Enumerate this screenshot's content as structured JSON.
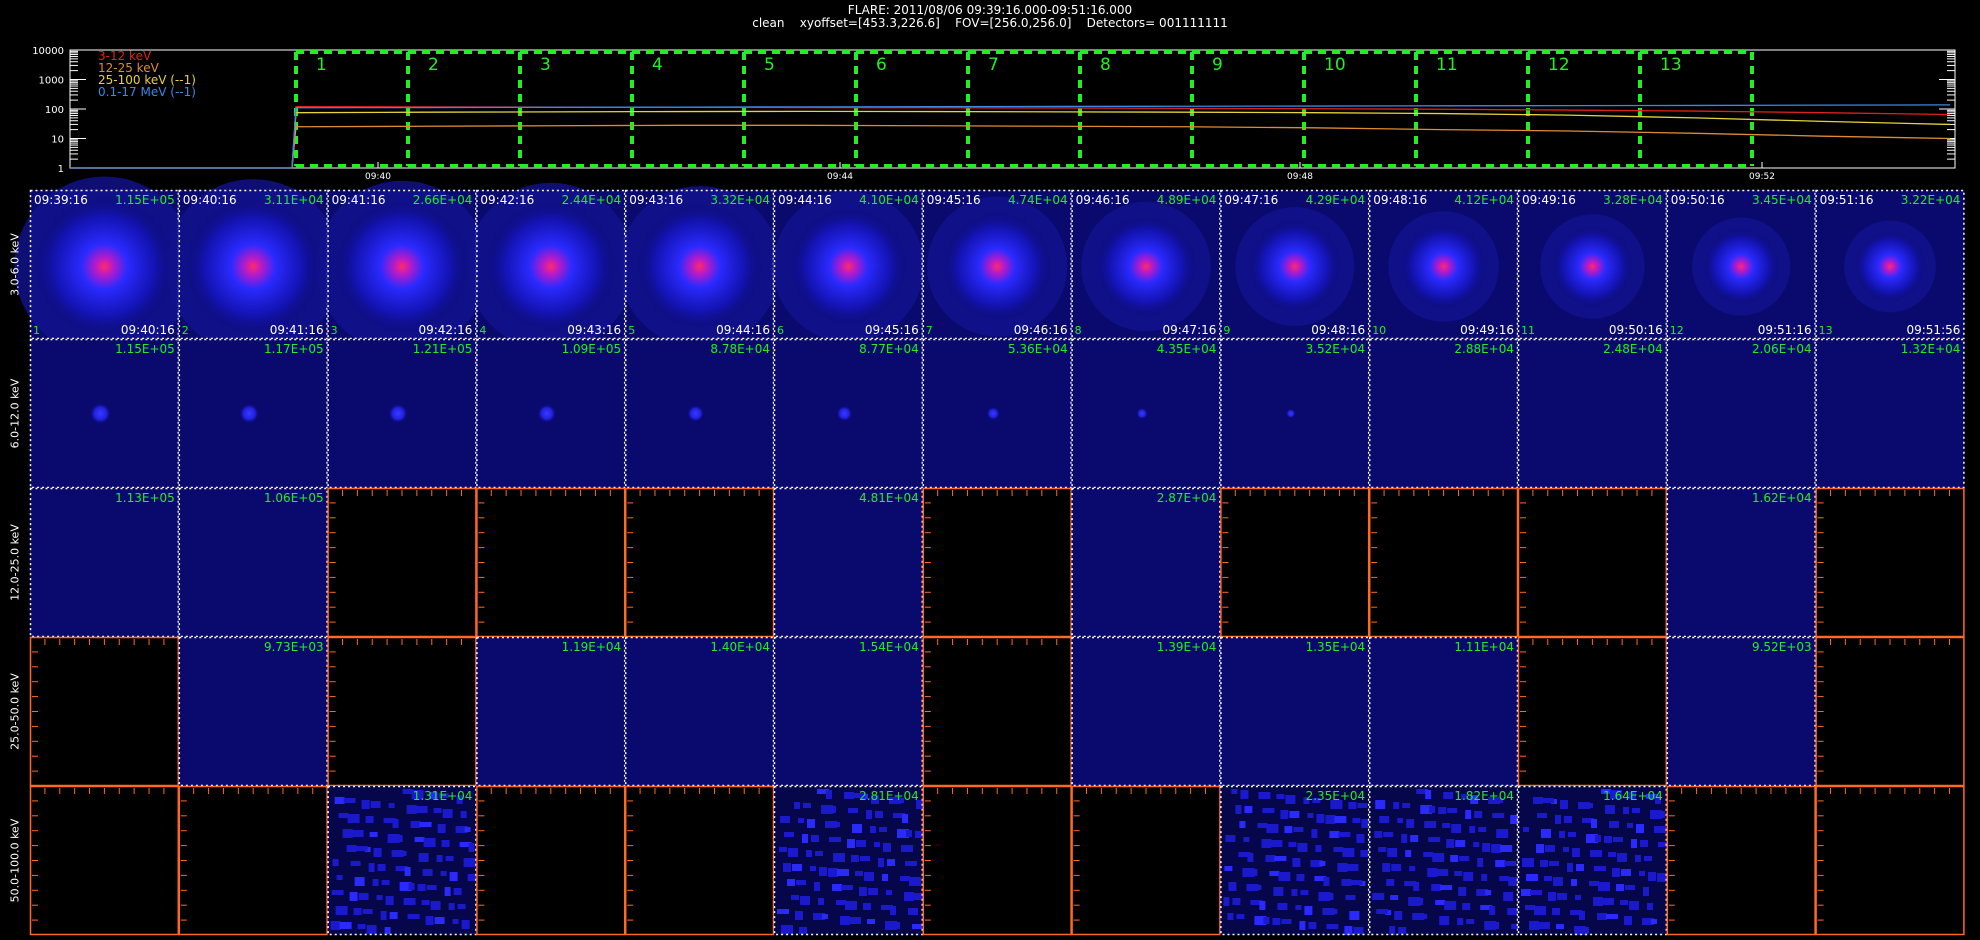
{
  "header": {
    "line1": "FLARE: 2011/08/06 09:39:16.000-09:51:16.000",
    "line2": "clean    xyoffset=[453.3,226.6]    FOV=[256.0,256.0]    Detectors= 001111111"
  },
  "colors": {
    "bg": "#000000",
    "c3_12": "#e0201c",
    "c12_25": "#e08a30",
    "c25_100": "#e6d23a",
    "c01_17": "#3a88e8",
    "interval": "#22ee22",
    "counts_label": "#22ee22",
    "frame_white": "#ffffff",
    "frame_orange": "#ff6a22",
    "image_blue": "#0a0a6e"
  },
  "chart_data": [
    {
      "type": "line",
      "title": "",
      "ylabel": "",
      "yscale": "log",
      "ylim": [
        1,
        10000
      ],
      "y_ticks": [
        "10000",
        "1000",
        "100",
        "10",
        "1"
      ],
      "x_ticks": [
        "09:40",
        "09:44",
        "09:48",
        "09:52"
      ],
      "legend": [
        "3-12 keV",
        "12-25 keV",
        "25-100 keV (--1)",
        "0.1-17 MeV (--1)"
      ],
      "legend_placement": "top-left",
      "series": [
        {
          "name": "3-12 keV",
          "values": [
            1,
            120,
            118,
            116,
            114,
            112,
            110,
            108,
            105,
            102,
            98,
            92,
            85,
            75,
            65
          ]
        },
        {
          "name": "12-25 keV",
          "values": [
            1,
            25,
            26,
            27,
            28,
            28,
            27,
            26,
            25,
            23,
            20,
            18,
            15,
            12,
            10
          ]
        },
        {
          "name": "25-100 keV (--1)",
          "values": [
            1,
            75,
            78,
            80,
            82,
            83,
            82,
            80,
            78,
            75,
            70,
            62,
            50,
            38,
            30
          ]
        },
        {
          "name": "0.1-17 MeV (--1)",
          "values": [
            1,
            110,
            112,
            114,
            116,
            118,
            120,
            122,
            124,
            126,
            128,
            130,
            132,
            135,
            138
          ]
        }
      ],
      "intervals": [
        "1",
        "2",
        "3",
        "4",
        "5",
        "6",
        "7",
        "8",
        "9",
        "10",
        "11",
        "12",
        "13"
      ]
    },
    {
      "type": "heatmap",
      "energy_bands": [
        "3.0-6.0 keV",
        "6.0-12.0 keV",
        "12.0-25.0 keV",
        "25.0-50.0 keV",
        "50.0-100.0 keV"
      ],
      "start_times": [
        "09:39:16",
        "09:40:16",
        "09:41:16",
        "09:42:16",
        "09:43:16",
        "09:44:16",
        "09:45:16",
        "09:46:16",
        "09:47:16",
        "09:48:16",
        "09:49:16",
        "09:50:16",
        "09:51:16"
      ],
      "end_times": [
        "09:40:16",
        "09:41:16",
        "09:42:16",
        "09:43:16",
        "09:44:16",
        "09:45:16",
        "09:46:16",
        "09:47:16",
        "09:48:16",
        "09:49:16",
        "09:50:16",
        "09:51:16",
        "09:51:56"
      ],
      "frame_numbers": [
        "1",
        "2",
        "3",
        "4",
        "5",
        "6",
        "7",
        "8",
        "9",
        "10",
        "11",
        "12",
        "13"
      ],
      "peak_counts": [
        [
          "1.15E+05",
          "3.11E+04",
          "2.66E+04",
          "2.44E+04",
          "3.32E+04",
          "4.10E+04",
          "4.74E+04",
          "4.89E+04",
          "4.29E+04",
          "4.12E+04",
          "3.28E+04",
          "3.45E+04",
          "3.22E+04"
        ],
        [
          "1.15E+05",
          "1.17E+05",
          "1.21E+05",
          "1.09E+05",
          "8.78E+04",
          "8.77E+04",
          "5.36E+04",
          "4.35E+04",
          "3.52E+04",
          "2.88E+04",
          "2.48E+04",
          "2.06E+04",
          "1.32E+04"
        ],
        [
          "1.13E+05",
          "1.06E+05",
          "",
          "",
          "",
          "4.81E+04",
          "",
          "2.87E+04",
          "",
          "",
          "",
          "1.62E+04",
          ""
        ],
        [
          "",
          "9.73E+03",
          "",
          "1.19E+04",
          "1.40E+04",
          "1.54E+04",
          "",
          "1.39E+04",
          "1.35E+04",
          "1.11E+04",
          "",
          "9.52E+03",
          ""
        ],
        [
          "",
          "",
          "1.31E+04",
          "",
          "",
          "2.81E+04",
          "",
          "",
          "2.35E+04",
          "1.82E+04",
          "1.64E+04",
          "",
          ""
        ]
      ],
      "source_intensity": [
        [
          1.0,
          0.95,
          0.92,
          0.88,
          0.82,
          0.72,
          0.62,
          0.52,
          0.42,
          0.34,
          0.28,
          0.22,
          0.16
        ],
        [
          0.55,
          0.5,
          0.48,
          0.45,
          0.38,
          0.33,
          0.22,
          0.14,
          0.06,
          0.0,
          0.0,
          0.0,
          0.0
        ],
        [
          0.0,
          0.0,
          0.0,
          0.0,
          0.0,
          0.0,
          0.0,
          0.0,
          0.0,
          0.0,
          0.0,
          0.0,
          0.0
        ],
        [
          0.0,
          0.0,
          0.0,
          0.0,
          0.0,
          0.0,
          0.0,
          0.0,
          0.0,
          0.0,
          0.0,
          0.0,
          0.0
        ],
        [
          0.0,
          0.0,
          0.0,
          0.0,
          0.0,
          0.0,
          0.0,
          0.0,
          0.0,
          0.0,
          0.0,
          0.0,
          0.0
        ]
      ]
    }
  ]
}
